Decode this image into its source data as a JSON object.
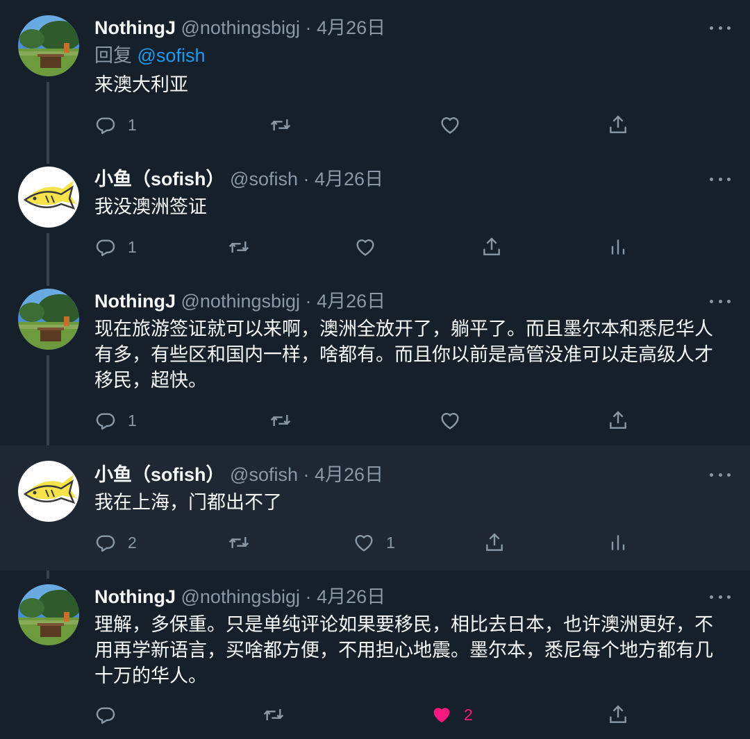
{
  "colors": {
    "background": "#15202b",
    "highlight": "#1e2732",
    "text": "#f7f9f9",
    "secondary": "#8b98a5",
    "link": "#1d9bf0",
    "like_active": "#f91880"
  },
  "tweets": [
    {
      "name": "NothingJ",
      "handle": "@nothingsbigj",
      "sep": "·",
      "time": "4月26日",
      "reply_prefix": "回复",
      "reply_mention": "@sofish",
      "text": "来澳大利亚",
      "reply_count": "1",
      "retweet_count": "",
      "like_count": "",
      "liked": false,
      "avatar": "park-avatar"
    },
    {
      "name": "小鱼（sofish）",
      "handle": "@sofish",
      "sep": "·",
      "time": "4月26日",
      "text": "我没澳洲签证",
      "reply_count": "1",
      "retweet_count": "",
      "like_count": "",
      "liked": false,
      "avatar": "fish-avatar",
      "has_analytics": true
    },
    {
      "name": "NothingJ",
      "handle": "@nothingsbigj",
      "sep": "·",
      "time": "4月26日",
      "text": "现在旅游签证就可以来啊，澳洲全放开了，躺平了。而且墨尔本和悉尼华人有多，有些区和国内一样，啥都有。而且你以前是高管没准可以走高级人才移民，超快。",
      "reply_count": "1",
      "retweet_count": "",
      "like_count": "",
      "liked": false,
      "avatar": "park-avatar"
    },
    {
      "name": "小鱼（sofish）",
      "handle": "@sofish",
      "sep": "·",
      "time": "4月26日",
      "text": "我在上海，门都出不了",
      "reply_count": "2",
      "retweet_count": "",
      "like_count": "1",
      "liked": false,
      "avatar": "fish-avatar",
      "has_analytics": true
    },
    {
      "name": "NothingJ",
      "handle": "@nothingsbigj",
      "sep": "·",
      "time": "4月26日",
      "text": "理解，多保重。只是单纯评论如果要移民，相比去日本，也许澳洲更好，不用再学新语言，买啥都方便，不用担心地震。墨尔本，悉尼每个地方都有几十万的华人。",
      "reply_count": "",
      "retweet_count": "",
      "like_count": "2",
      "liked": true,
      "avatar": "park-avatar"
    }
  ]
}
